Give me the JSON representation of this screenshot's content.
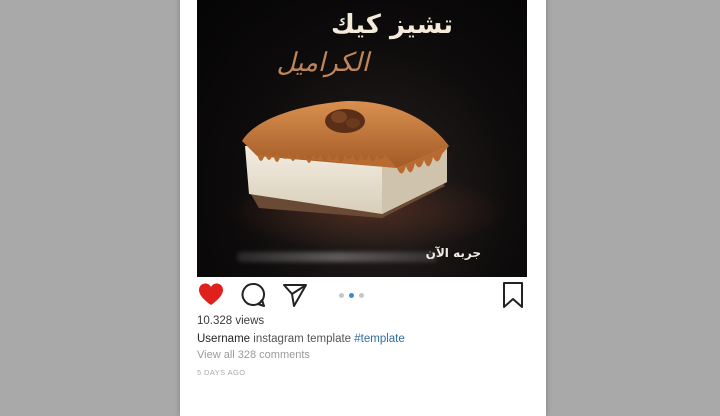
{
  "post": {
    "image": {
      "title_ar": "تشيز كيك",
      "subtitle_ar": "الكراميل",
      "caption_ar": "جربه الآن"
    },
    "actions": {
      "like_icon": "heart-icon",
      "comment_icon": "comment-icon",
      "share_icon": "send-icon",
      "save_icon": "bookmark-icon",
      "liked_color": "#e0201c"
    },
    "carousel": {
      "total": 3,
      "active_index": 1
    },
    "views": "10.328 views",
    "caption": {
      "username": "Username",
      "text": "instagram template",
      "hashtag": "#template"
    },
    "comments_link": "View all 328 comments",
    "timestamp": "5 DAYS AGO"
  }
}
